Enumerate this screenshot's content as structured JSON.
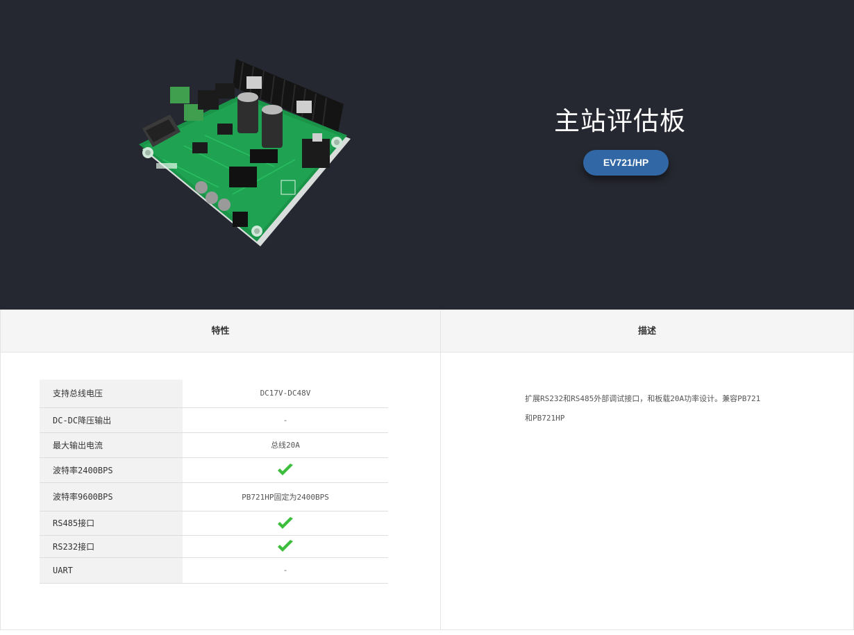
{
  "hero": {
    "title": "主站评估板",
    "model_button": "EV721/HP",
    "colors": {
      "background": "#262831",
      "button": "#3167a4"
    }
  },
  "features": {
    "heading": "特性",
    "rows": [
      {
        "label": "支持总线电压",
        "value": "DC17V-DC48V",
        "check": false
      },
      {
        "label": "DC-DC降压输出",
        "value": "-",
        "check": false
      },
      {
        "label": "最大输出电流",
        "value": "总线20A",
        "check": false
      },
      {
        "label": "波特率2400BPS",
        "value": "",
        "check": true
      },
      {
        "label": "波特率9600BPS",
        "value": "PB721HP固定为2400BPS",
        "check": false
      },
      {
        "label": "RS485接口",
        "value": "",
        "check": true
      },
      {
        "label": "RS232接口",
        "value": "",
        "check": true
      },
      {
        "label": "UART",
        "value": "-",
        "check": false
      }
    ],
    "check_icon": "check-icon",
    "check_color": "#3cbd3c"
  },
  "description": {
    "heading": "描述",
    "text": "扩展RS232和RS485外部调试接口，和板载20A功率设计。兼容PB721和PB721HP"
  }
}
